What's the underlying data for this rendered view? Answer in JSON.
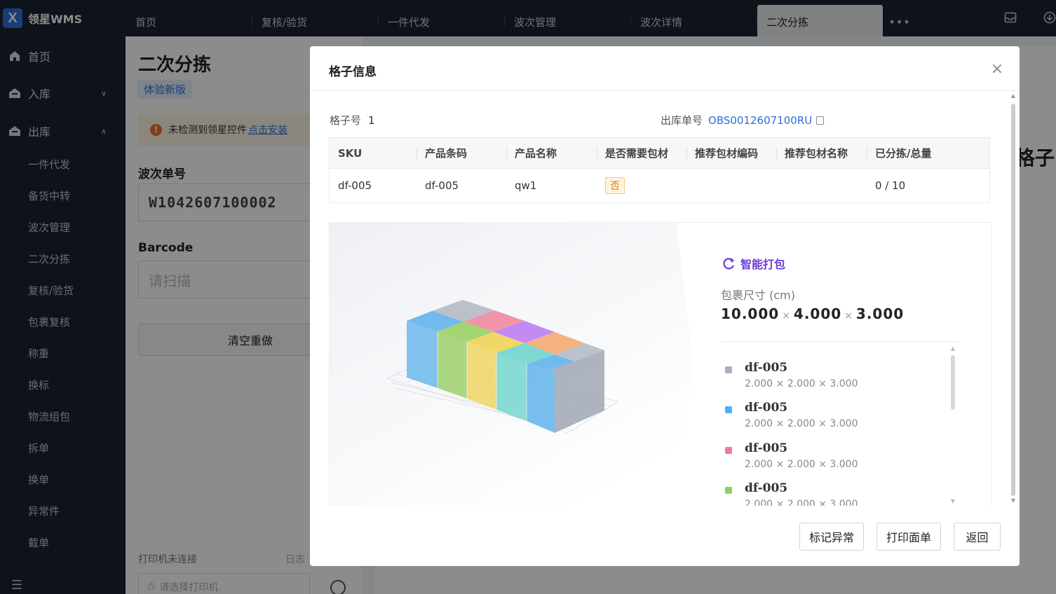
{
  "app": {
    "logo_letter": "X",
    "name": "领星WMS"
  },
  "topbar": {
    "tabs": [
      {
        "label": "首页"
      },
      {
        "label": "复核/验货"
      },
      {
        "label": "一件代发"
      },
      {
        "label": "波次管理"
      },
      {
        "label": "波次详情"
      },
      {
        "label": "二次分拣",
        "active": true
      }
    ],
    "more": "•••"
  },
  "sidebar": {
    "items": [
      {
        "label": "首页",
        "icon": "home-icon"
      },
      {
        "label": "入库",
        "icon": "inbound-icon",
        "arrow": "∨"
      },
      {
        "label": "出库",
        "icon": "outbound-icon",
        "arrow": "∧"
      }
    ],
    "sub_items": [
      "一件代发",
      "备货中转",
      "波次管理",
      "二次分拣",
      "复核/验货",
      "包裹复核",
      "称重",
      "换标",
      "物流组包",
      "拆单",
      "换单",
      "异常件",
      "截单"
    ]
  },
  "page": {
    "title": "二次分拣",
    "trial_badge": "体验新版",
    "warning": {
      "icon": "!",
      "text": "未检测到领星控件",
      "link": "点击安装"
    },
    "wave_label": "波次单号",
    "wave_value": "W1042607100002",
    "barcode_label": "Barcode",
    "barcode_placeholder": "请扫描",
    "reset_button": "清空重做",
    "printer_status": "打印机未连接",
    "log_link": "日志",
    "printer_placeholder": "请选择打印机",
    "right_title": "格子"
  },
  "modal": {
    "title": "格子信息",
    "close": "×",
    "grid_label": "格子号",
    "grid_value": "1",
    "order_label": "出库单号",
    "order_value": "OBS0012607100RU",
    "table": {
      "headers": [
        "SKU",
        "产品条码",
        "产品名称",
        "是否需要包材",
        "推荐包材编码",
        "推荐包材名称",
        "已分拣/总量"
      ],
      "rows": [
        {
          "sku": "df-005",
          "barcode": "df-005",
          "name": "qw1",
          "need_pack": "否",
          "pack_code": "",
          "pack_name": "",
          "progress": "0 / 10"
        }
      ]
    },
    "smart_pack": {
      "label": "智能打包",
      "size_label": "包裹尺寸 (cm)",
      "dim1": "10.000",
      "dim2": "4.000",
      "dim3": "3.000",
      "times": "×",
      "items": [
        {
          "name": "df-005",
          "size": "2.000 × 2.000 × 3.000",
          "color": "#a9afbf"
        },
        {
          "name": "df-005",
          "size": "2.000 × 2.000 × 3.000",
          "color": "#4cb0ef"
        },
        {
          "name": "df-005",
          "size": "2.000 × 2.000 × 3.000",
          "color": "#f07d95"
        },
        {
          "name": "df-005",
          "size": "2.000 × 2.000 × 3.000",
          "color": "#8fd05a"
        }
      ]
    },
    "buttons": {
      "mark_exception": "标记异常",
      "print_label": "打印面单",
      "back": "返回"
    }
  }
}
